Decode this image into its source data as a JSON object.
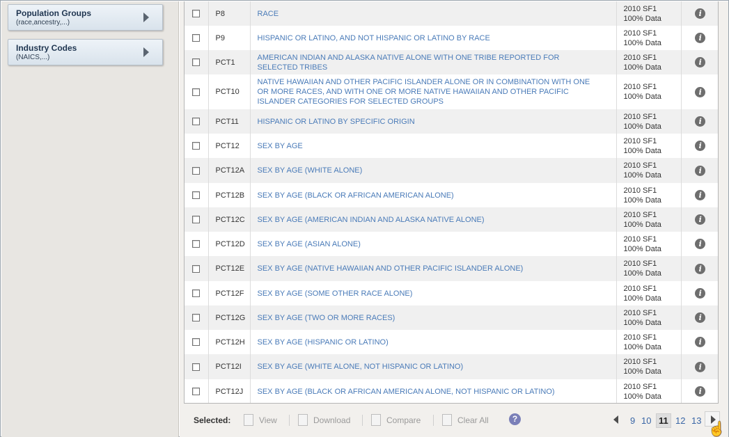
{
  "sidebar": {
    "buttons": [
      {
        "title": "Population Groups",
        "subtitle": "(race,ancestry,...)"
      },
      {
        "title": "Industry Codes",
        "subtitle": "(NAICS,...)"
      }
    ]
  },
  "table": {
    "rows": [
      {
        "id": "P8",
        "title": "RACE",
        "dataset_line1": "2010 SF1",
        "dataset_line2": "100% Data"
      },
      {
        "id": "P9",
        "title": "HISPANIC OR LATINO, AND NOT HISPANIC OR LATINO BY RACE",
        "dataset_line1": "2010 SF1",
        "dataset_line2": "100% Data"
      },
      {
        "id": "PCT1",
        "title": "AMERICAN INDIAN AND ALASKA NATIVE ALONE WITH ONE TRIBE REPORTED FOR SELECTED TRIBES",
        "dataset_line1": "2010 SF1",
        "dataset_line2": "100% Data"
      },
      {
        "id": "PCT10",
        "title": "NATIVE HAWAIIAN AND OTHER PACIFIC ISLANDER ALONE OR IN COMBINATION WITH ONE OR MORE RACES, AND WITH ONE OR MORE NATIVE HAWAIIAN AND OTHER PACIFIC ISLANDER CATEGORIES FOR SELECTED GROUPS",
        "dataset_line1": "2010 SF1",
        "dataset_line2": "100% Data"
      },
      {
        "id": "PCT11",
        "title": "HISPANIC OR LATINO BY SPECIFIC ORIGIN",
        "dataset_line1": "2010 SF1",
        "dataset_line2": "100% Data"
      },
      {
        "id": "PCT12",
        "title": "SEX BY AGE",
        "dataset_line1": "2010 SF1",
        "dataset_line2": "100% Data"
      },
      {
        "id": "PCT12A",
        "title": "SEX BY AGE (WHITE ALONE)",
        "dataset_line1": "2010 SF1",
        "dataset_line2": "100% Data"
      },
      {
        "id": "PCT12B",
        "title": "SEX BY AGE (BLACK OR AFRICAN AMERICAN ALONE)",
        "dataset_line1": "2010 SF1",
        "dataset_line2": "100% Data"
      },
      {
        "id": "PCT12C",
        "title": "SEX BY AGE (AMERICAN INDIAN AND ALASKA NATIVE ALONE)",
        "dataset_line1": "2010 SF1",
        "dataset_line2": "100% Data"
      },
      {
        "id": "PCT12D",
        "title": "SEX BY AGE (ASIAN ALONE)",
        "dataset_line1": "2010 SF1",
        "dataset_line2": "100% Data"
      },
      {
        "id": "PCT12E",
        "title": "SEX BY AGE (NATIVE HAWAIIAN AND OTHER PACIFIC ISLANDER ALONE)",
        "dataset_line1": "2010 SF1",
        "dataset_line2": "100% Data"
      },
      {
        "id": "PCT12F",
        "title": "SEX BY AGE (SOME OTHER RACE ALONE)",
        "dataset_line1": "2010 SF1",
        "dataset_line2": "100% Data"
      },
      {
        "id": "PCT12G",
        "title": "SEX BY AGE (TWO OR MORE RACES)",
        "dataset_line1": "2010 SF1",
        "dataset_line2": "100% Data"
      },
      {
        "id": "PCT12H",
        "title": "SEX BY AGE (HISPANIC OR LATINO)",
        "dataset_line1": "2010 SF1",
        "dataset_line2": "100% Data"
      },
      {
        "id": "PCT12I",
        "title": "SEX BY AGE (WHITE ALONE, NOT HISPANIC OR LATINO)",
        "dataset_line1": "2010 SF1",
        "dataset_line2": "100% Data"
      },
      {
        "id": "PCT12J",
        "title": "SEX BY AGE (BLACK OR AFRICAN AMERICAN ALONE, NOT HISPANIC OR LATINO)",
        "dataset_line1": "2010 SF1",
        "dataset_line2": "100% Data"
      }
    ]
  },
  "footer": {
    "selected_label": "Selected:",
    "view_label": "View",
    "download_label": "Download",
    "compare_label": "Compare",
    "clear_all_label": "Clear All",
    "help_icon": "?",
    "pages": [
      "9",
      "10",
      "11",
      "12",
      "13"
    ],
    "current_page": "11"
  },
  "colors": {
    "link": "#4a7bb8",
    "row_alt": "#f0f0f0",
    "sidebar_bg": "#e8e6e2"
  }
}
